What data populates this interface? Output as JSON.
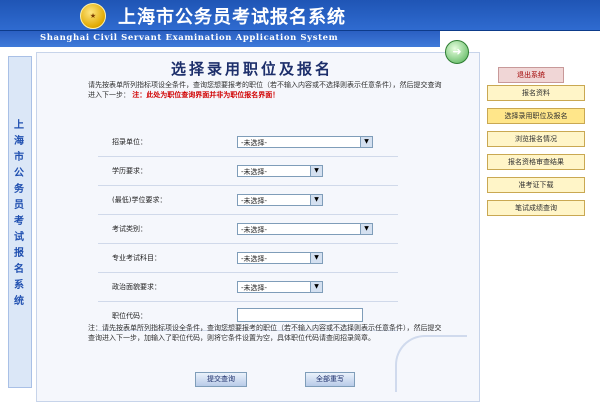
{
  "header": {
    "title_cn": "上海市公务员考试报名系统",
    "title_en": "Shanghai Civil Servant Examination Application System"
  },
  "sidebar_vertical_title": "上\n海\n市\n公\n务\n员\n考\n试\n报\n名\n系\n统",
  "page": {
    "title": "选择录用职位及报名",
    "instruction_top": "请先按表单所列指标项设全条件，查询您想要报考的职位（若不输入内容或不选择则表示任意条件），然后提交查询进入下一步：",
    "instruction_top_red": "注：此处为职位查询界面并非为职位报名界面！",
    "instruction_bottom": "注：请先按表单所列指标项设全条件，查询您想要报考的职位（若不输入内容或不选择则表示任意条件），然后提交查询进入下一步，加输入了职位代码，则将它条件设置为空，具体职位代码请查阅招录简章。"
  },
  "form": {
    "fields": [
      {
        "label": "招录单位：",
        "value": "-未选择-"
      },
      {
        "label": "学历要求：",
        "value": "-未选择-"
      },
      {
        "label": "(最低)学位要求：",
        "value": "-未选择-"
      },
      {
        "label": "考试类别：",
        "value": "-未选择-"
      },
      {
        "label": "专业考试科目：",
        "value": "-未选择-"
      },
      {
        "label": "政治面貌要求：",
        "value": "-未选择-"
      },
      {
        "label": "职位代码：",
        "value": ""
      }
    ]
  },
  "buttons": {
    "submit": "提交查询",
    "reset": "全部重写"
  },
  "nav": {
    "exit": "退出系统",
    "items": [
      "报名资料",
      "选择录用职位及报名",
      "浏览报名情况",
      "报名资格审查结果",
      "准考证下载",
      "笔试成绩查询"
    ]
  },
  "colors": {
    "header_blue": "#2f6bd0",
    "menu_yellow": "#fff5c8",
    "exit_red": "#a00000"
  }
}
